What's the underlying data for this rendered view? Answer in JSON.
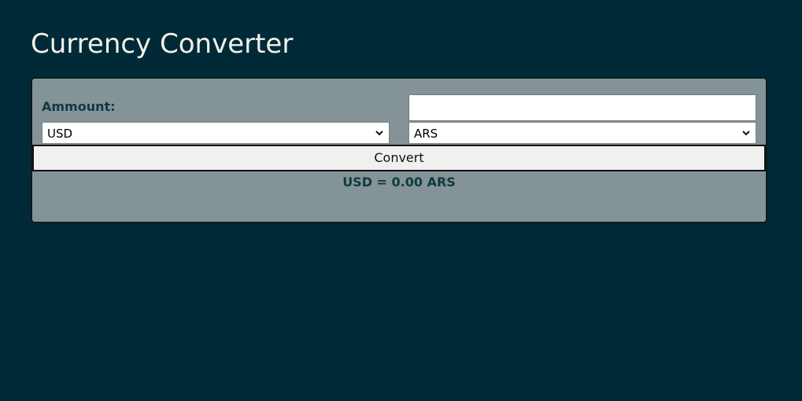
{
  "header": {
    "title": "Currency Converter"
  },
  "form": {
    "amount_label": "Ammount:",
    "amount_value": "",
    "amount_placeholder": "",
    "from_currency": "USD",
    "to_currency": "ARS",
    "convert_label": "Convert",
    "result_text": "USD = 0.00 ARS"
  },
  "colors": {
    "background": "#002a38",
    "card": "#849395",
    "accent_text": "#0f3a44"
  }
}
